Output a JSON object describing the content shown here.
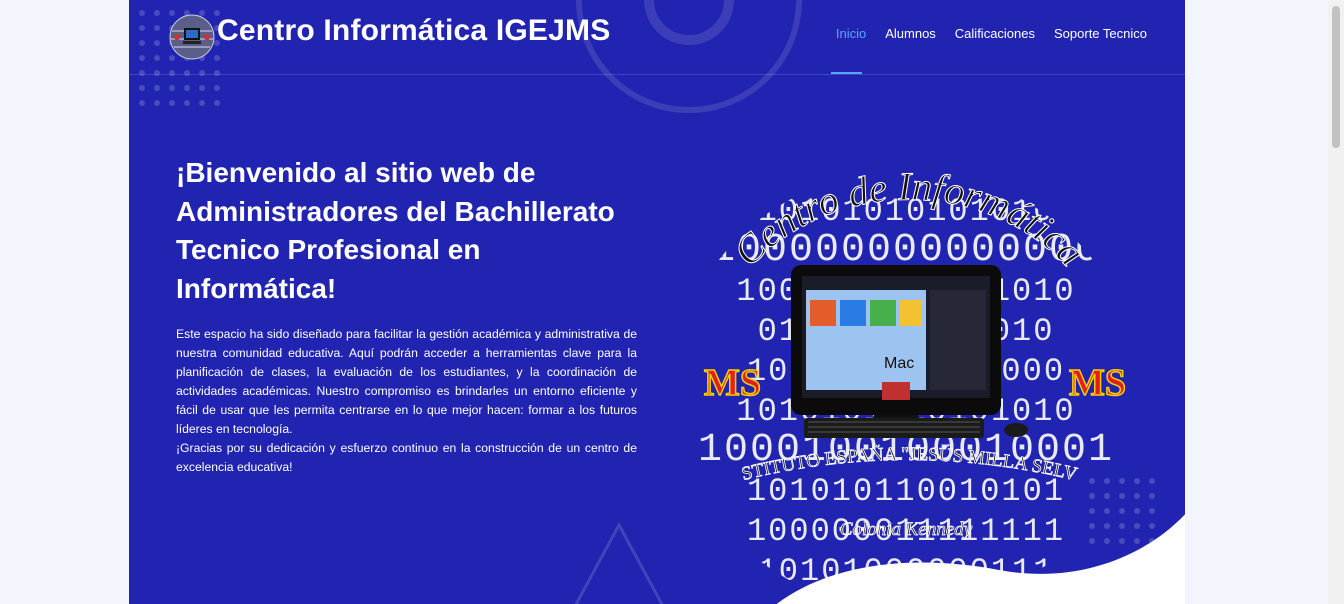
{
  "brand": {
    "title": "Centro Informática IGEJMS",
    "logo_icon": "globe-computer-logo"
  },
  "nav": {
    "items": [
      {
        "label": "Inicio",
        "active": true
      },
      {
        "label": "Alumnos",
        "active": false
      },
      {
        "label": "Calificaciones",
        "active": false
      },
      {
        "label": "Soporte Tecnico",
        "active": false
      }
    ]
  },
  "hero": {
    "title": "¡Bienvenido al sitio web de Administradores del Bachillerato Tecnico Profesional en Informática!",
    "paragraph": "Este espacio ha sido diseñado para facilitar la gestión académica y administrativa de nuestra comunidad educativa. Aquí podrán acceder a herramientas clave para la planificación de clases, la evaluación de los estudiantes, y la coordinación de actividades académicas. Nuestro compromiso es brindarles un entorno eficiente y fácil de usar que les permita centrarse en lo que mejor hacen: formar a los futuros líderes en tecnología.",
    "thanks": "¡Gracias por su dedicación y esfuerzo continuo en la construcción de un centro de excelencia educativa!"
  },
  "image": {
    "arc_top": "Centro de Informática",
    "arc_bottom": "INSTITUTO ESPAÑA \"JESÚS MILLA SELVA\"",
    "subtitle": "Colonia Kennedy",
    "badge": "MS",
    "screen_label": "Mac",
    "binary_rows": [
      "10101010101010",
      "100000000000000",
      "1000010010101010",
      "01010110101010",
      "101011001000000",
      "1010101010101010",
      "1000100100010001",
      "101010110010101",
      "100000011111111",
      "10101000000111"
    ]
  },
  "colors": {
    "background": "#2124b0",
    "accent": "#5aa5ff",
    "page_bg": "#f3f5fc"
  }
}
